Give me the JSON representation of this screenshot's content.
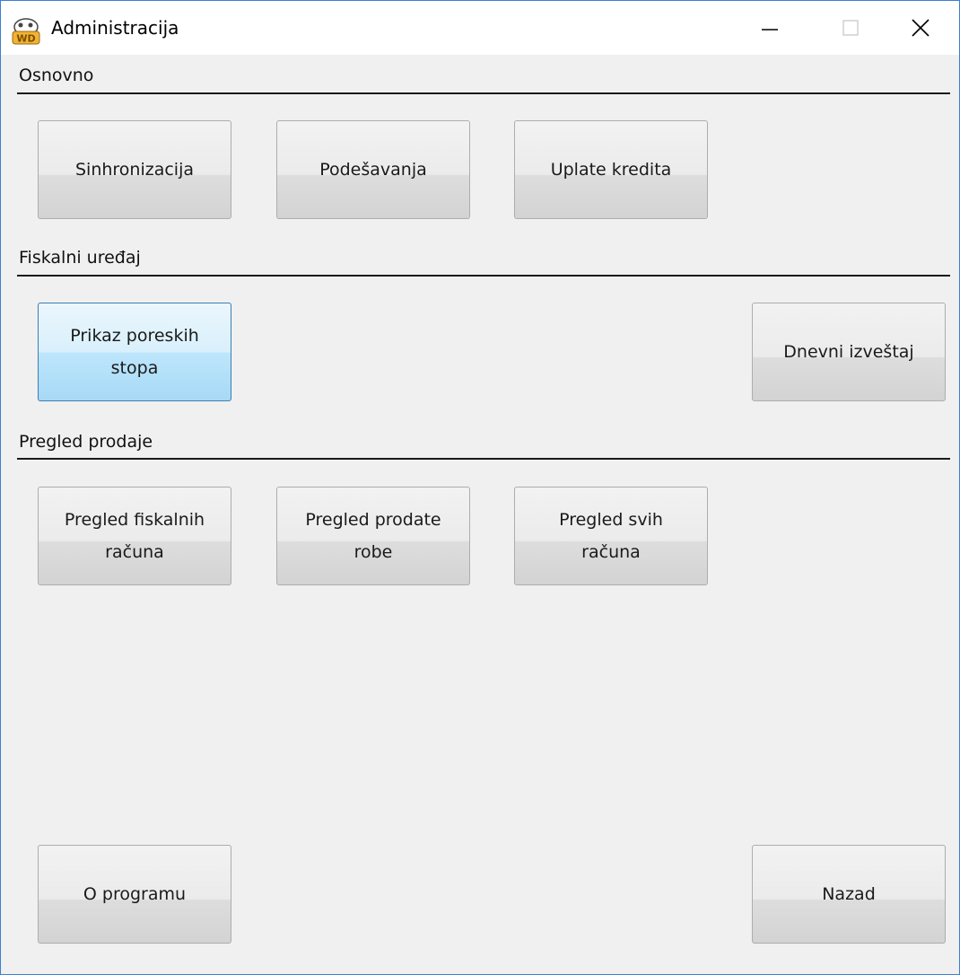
{
  "window": {
    "title": "Administracija",
    "icon": "wd-app-icon",
    "controls": [
      "minimize-icon",
      "maximize-icon",
      "close-icon"
    ]
  },
  "sections": {
    "osnovno": {
      "label": "Osnovno",
      "buttons": [
        "Sinhronizacija",
        "Podešavanja",
        "Uplate kredita"
      ]
    },
    "fiskalni": {
      "label": "Fiskalni uređaj",
      "buttons": [
        "Prikaz poreskih\nstopa",
        "Dnevni izveštaj"
      ]
    },
    "pregled": {
      "label": "Pregled prodaje",
      "buttons": [
        "Pregled fiskalnih\nračuna",
        "Pregled prodate\nrobe",
        "Pregled svih\nračuna"
      ]
    }
  },
  "footer": {
    "about_label": "O programu",
    "back_label": "Nazad"
  },
  "colors": {
    "window_border": "#3a7fd0",
    "active_button": "#bee6fd"
  }
}
